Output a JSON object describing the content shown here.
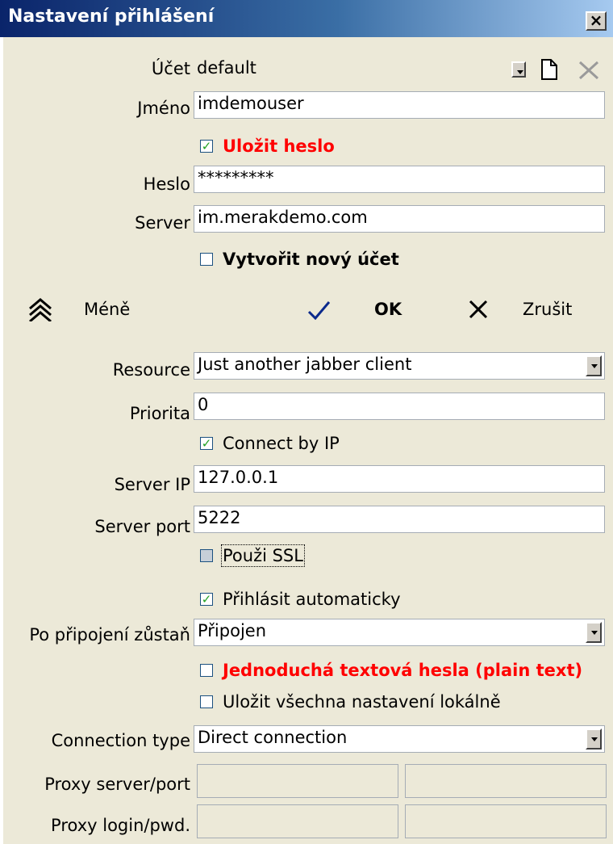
{
  "window": {
    "title": "Nastavení přihlášení",
    "close_glyph": "×"
  },
  "account": {
    "label": "Účet",
    "value": "default"
  },
  "name": {
    "label": "Jméno",
    "value": "imdemouser"
  },
  "save_password": {
    "label": "Uložit heslo",
    "checked": true
  },
  "password": {
    "label": "Heslo",
    "value": "*********"
  },
  "server": {
    "label": "Server",
    "value": "im.merakdemo.com"
  },
  "new_account": {
    "label": "Vytvořit nový účet",
    "checked": false
  },
  "buttons": {
    "less": "Méně",
    "ok": "OK",
    "cancel": "Zrušit"
  },
  "resource": {
    "label": "Resource",
    "value": "Just another jabber client"
  },
  "priority": {
    "label": "Priorita",
    "value": "0"
  },
  "connect_by_ip": {
    "label": "Connect by IP",
    "checked": true
  },
  "server_ip": {
    "label": "Server IP",
    "value": "127.0.0.1"
  },
  "server_port": {
    "label": "Server port",
    "value": "5222"
  },
  "use_ssl": {
    "label": "Použi SSL",
    "checked": false
  },
  "auto_login": {
    "label": "Přihlásit automaticky",
    "checked": true
  },
  "after_connect": {
    "label": "Po připojení zůstaň",
    "value": "Připojen"
  },
  "plain_text": {
    "label": "Jednoduchá textová hesla (plain text)",
    "checked": false
  },
  "save_local": {
    "label": "Uložit všechna nastavení lokálně",
    "checked": false
  },
  "connection_type": {
    "label": "Connection type",
    "value": "Direct connection"
  },
  "proxy_server": {
    "label": "Proxy server/port",
    "server": "",
    "port": ""
  },
  "proxy_login": {
    "label": "Proxy login/pwd.",
    "login": "",
    "pwd": ""
  },
  "colors": {
    "title_start": "#0a246a",
    "title_end": "#a6caf0",
    "warning": "#ff0000",
    "background": "#ece9d8"
  },
  "icons": [
    "new-document-icon",
    "delete-icon",
    "collapse-chevron-icon",
    "ok-check-icon",
    "cancel-x-icon",
    "dropdown-arrow-icon"
  ]
}
